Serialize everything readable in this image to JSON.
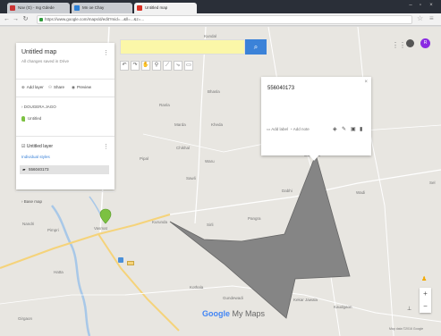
{
  "browser": {
    "tabs": [
      {
        "label": "Nav (G) - Ing Gdede"
      },
      {
        "label": "Mn oe Chay"
      },
      {
        "label": "Untitled map"
      }
    ],
    "url": "https://www.google.com/maps/d/edit?mid=...&ll=...&z=...",
    "colors": {
      "chrome": "#2a2f38",
      "tab": "#c9ccd1",
      "active_tab": "#f2f2f2"
    }
  },
  "toolbar": {
    "search_button_icon": "search-icon",
    "tools": [
      "undo-icon",
      "redo-icon",
      "hand-icon",
      "marker-icon",
      "line-icon",
      "route-icon",
      "ruler-icon"
    ]
  },
  "panel": {
    "title": "Untitled map",
    "subtitle": "All changes saved in Drive",
    "actions": [
      {
        "label": "Add layer",
        "icon": "add-layer-icon"
      },
      {
        "label": "Share",
        "icon": "share-icon"
      },
      {
        "label": "Preview",
        "icon": "preview-icon"
      }
    ],
    "layer_label": "DOUGERA JAGO",
    "marker_label": "Untitled",
    "untitled_layer": "Untitled layer",
    "individual_styles": "Individual styles",
    "polygon_item": "556040173",
    "base_map": "Base map"
  },
  "popup": {
    "title": "556040173",
    "actions": [
      "Add label",
      "Add note"
    ],
    "close_icon": "close-icon"
  },
  "map": {
    "polygon_color": "#858585",
    "marker_color": "#7cc142",
    "logo_text": "Google",
    "logo_suffix": "My Maps",
    "attribution": "Map data ©2016 Google"
  },
  "user": {
    "avatar_initial": "R",
    "avatar_color": "#8a2be2"
  }
}
